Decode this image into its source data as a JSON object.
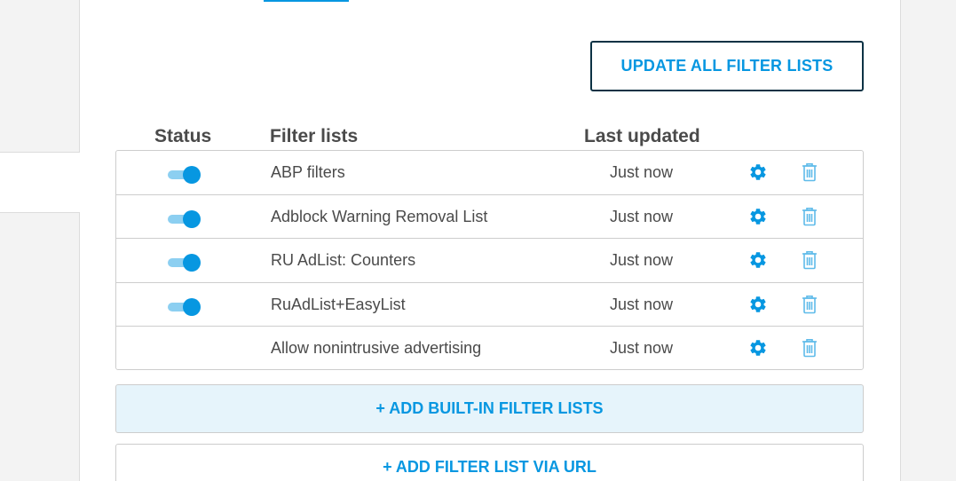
{
  "actions": {
    "update_all_label": "UPDATE ALL FILTER LISTS",
    "add_builtin_label": "+ ADD BUILT-IN FILTER LISTS",
    "add_url_label": "+ ADD FILTER LIST VIA URL"
  },
  "table": {
    "headers": {
      "status": "Status",
      "filter_lists": "Filter lists",
      "last_updated": "Last updated"
    },
    "rows": [
      {
        "name": "ABP filters",
        "updated": "Just now",
        "enabled": true
      },
      {
        "name": "Adblock Warning Removal List",
        "updated": "Just now",
        "enabled": true
      },
      {
        "name": "RU AdList: Counters",
        "updated": "Just now",
        "enabled": true
      },
      {
        "name": "RuAdList+EasyList",
        "updated": "Just now",
        "enabled": true
      },
      {
        "name": "Allow nonintrusive advertising",
        "updated": "Just now",
        "enabled": null
      }
    ],
    "row_icons": [
      "gear-icon",
      "trash-icon"
    ]
  },
  "colors": {
    "accent": "#0797e1",
    "accent_light": "#8ccff1",
    "button_border": "#0c3244",
    "builtin_bg": "#e6f4fb"
  }
}
